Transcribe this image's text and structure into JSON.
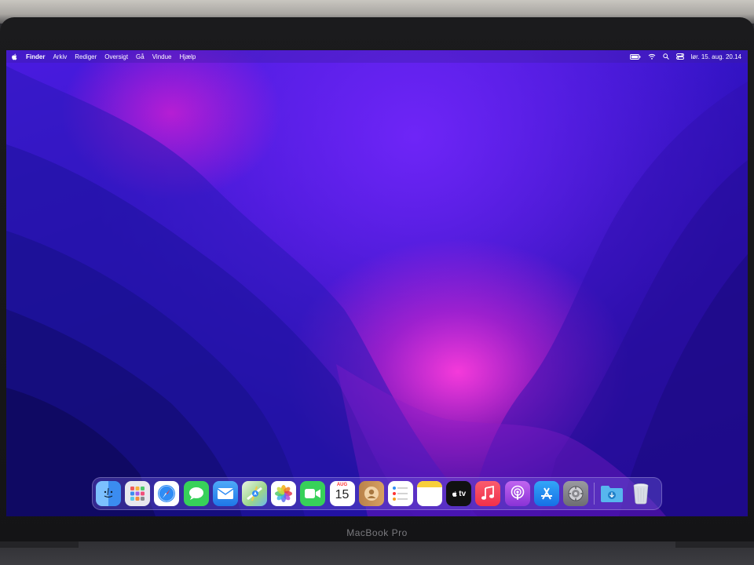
{
  "device": {
    "label": "MacBook Pro"
  },
  "menubar": {
    "app_name": "Finder",
    "menus": [
      "Arkiv",
      "Rediger",
      "Oversigt",
      "Gå",
      "Vindue",
      "Hjælp"
    ],
    "status_icons": [
      "battery-icon",
      "wifi-icon",
      "spotlight-search-icon",
      "control-center-icon"
    ],
    "clock": "lør. 15. aug.  20.14"
  },
  "dock": {
    "apps": [
      {
        "name": "finder-icon",
        "color": "#3b8cf0"
      },
      {
        "name": "launchpad-icon",
        "color": "#e8e8ee"
      },
      {
        "name": "safari-icon",
        "color": "#ffffff"
      },
      {
        "name": "messages-icon",
        "color": "#37d159"
      },
      {
        "name": "mail-icon",
        "color": "#2f8cf5"
      },
      {
        "name": "maps-icon",
        "color": "#6cd06c"
      },
      {
        "name": "photos-icon",
        "color": "#ffffff"
      },
      {
        "name": "facetime-icon",
        "color": "#37d159"
      },
      {
        "name": "calendar-icon",
        "color": "#ffffff"
      },
      {
        "name": "contacts-icon",
        "color": "#c98f50"
      },
      {
        "name": "reminders-icon",
        "color": "#ffffff"
      },
      {
        "name": "notes-icon",
        "color": "#ffffff"
      },
      {
        "name": "apple-tv-icon",
        "color": "#111111"
      },
      {
        "name": "music-icon",
        "color": "#f53c55"
      },
      {
        "name": "podcasts-icon",
        "color": "#a447e0"
      },
      {
        "name": "app-store-icon",
        "color": "#1f8ef2"
      },
      {
        "name": "system-preferences-icon",
        "color": "#8a8a8e"
      }
    ],
    "calendar": {
      "month": "AUG",
      "day": "15"
    },
    "tv_label": "tv",
    "downloads": {
      "name": "downloads-folder-icon",
      "color": "#57b6ee"
    },
    "trash": {
      "name": "trash-icon",
      "color": "#d8dde6"
    }
  }
}
